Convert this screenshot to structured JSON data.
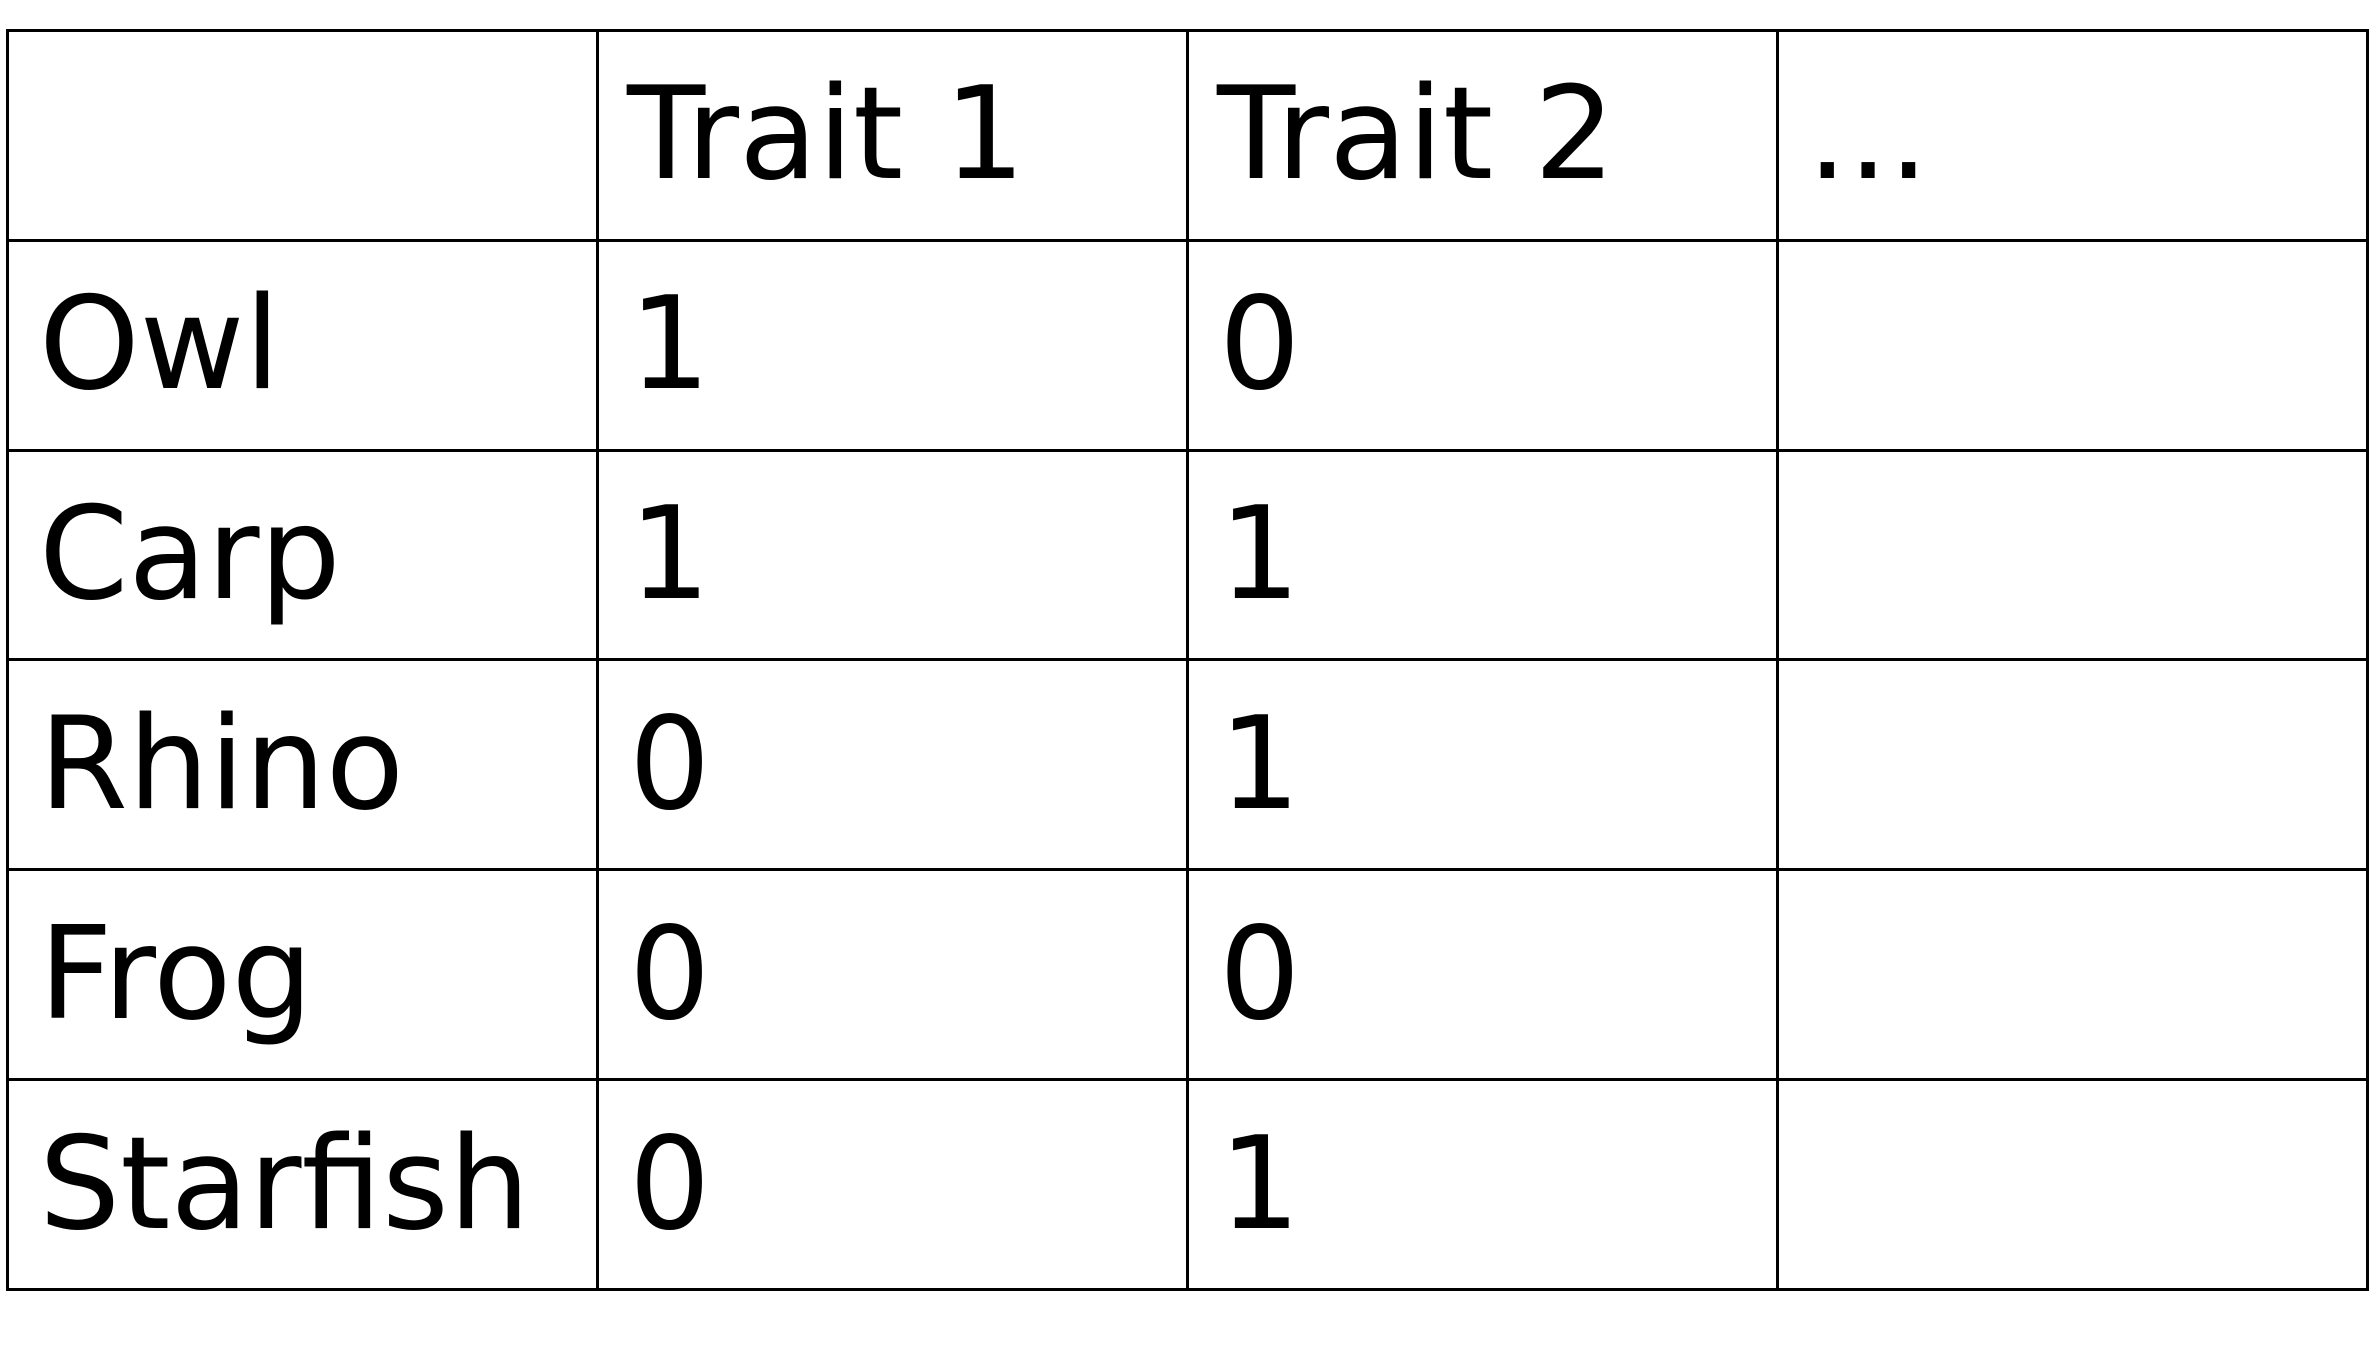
{
  "table": {
    "header": [
      "",
      "Trait 1",
      "Trait 2",
      "..."
    ],
    "rows": [
      {
        "name": "Owl",
        "values": [
          "1",
          "0",
          ""
        ]
      },
      {
        "name": "Carp",
        "values": [
          "1",
          "1",
          ""
        ]
      },
      {
        "name": "Rhino",
        "values": [
          "0",
          "1",
          ""
        ]
      },
      {
        "name": "Frog",
        "values": [
          "0",
          "0",
          ""
        ]
      },
      {
        "name": "Starfish",
        "values": [
          "0",
          "1",
          ""
        ]
      }
    ]
  },
  "colors": {
    "text": "#000000",
    "border": "#000000",
    "background": "#ffffff"
  }
}
